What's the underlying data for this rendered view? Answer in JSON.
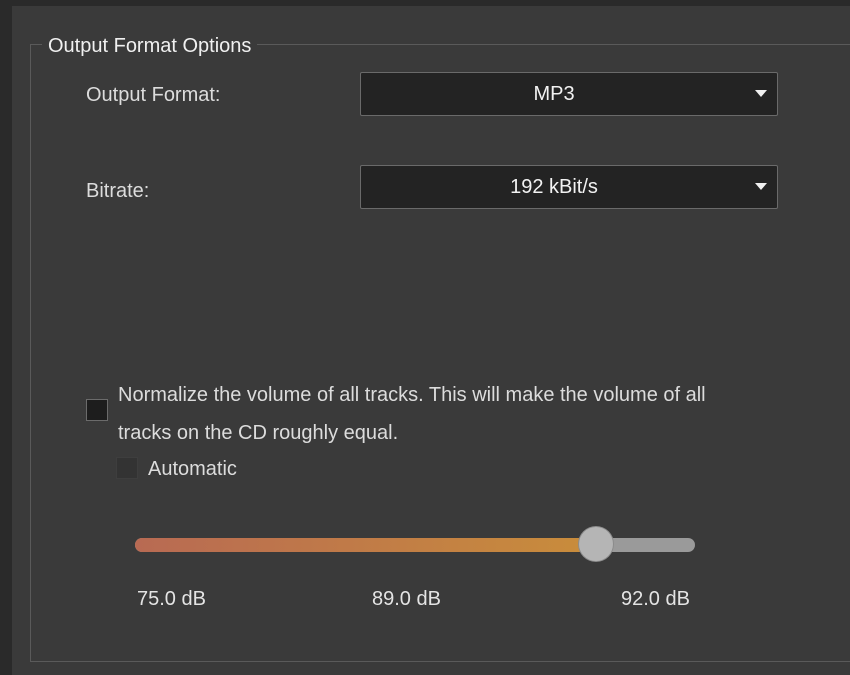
{
  "group": {
    "title": "Output Format Options"
  },
  "output_format": {
    "label": "Output Format:",
    "value": "MP3",
    "caret_icon": "dropdown-arrow-icon"
  },
  "bitrate": {
    "label": "Bitrate:",
    "value": "192 kBit/s",
    "caret_icon": "dropdown-arrow-icon"
  },
  "normalize": {
    "text": "Normalize the volume of all tracks. This will make the volume of all tracks on the CD roughly equal.",
    "checked": false
  },
  "automatic": {
    "label": "Automatic",
    "checked": false,
    "enabled": false
  },
  "volume_slider": {
    "min_label": "75.0 dB",
    "value_label": "89.0 dB",
    "max_label": "92.0 dB",
    "min": 75.0,
    "max": 92.0,
    "value": 89.0,
    "fill_colors": [
      "#b86a53",
      "#c98d3b"
    ],
    "track_color": "#9a9a9a"
  }
}
